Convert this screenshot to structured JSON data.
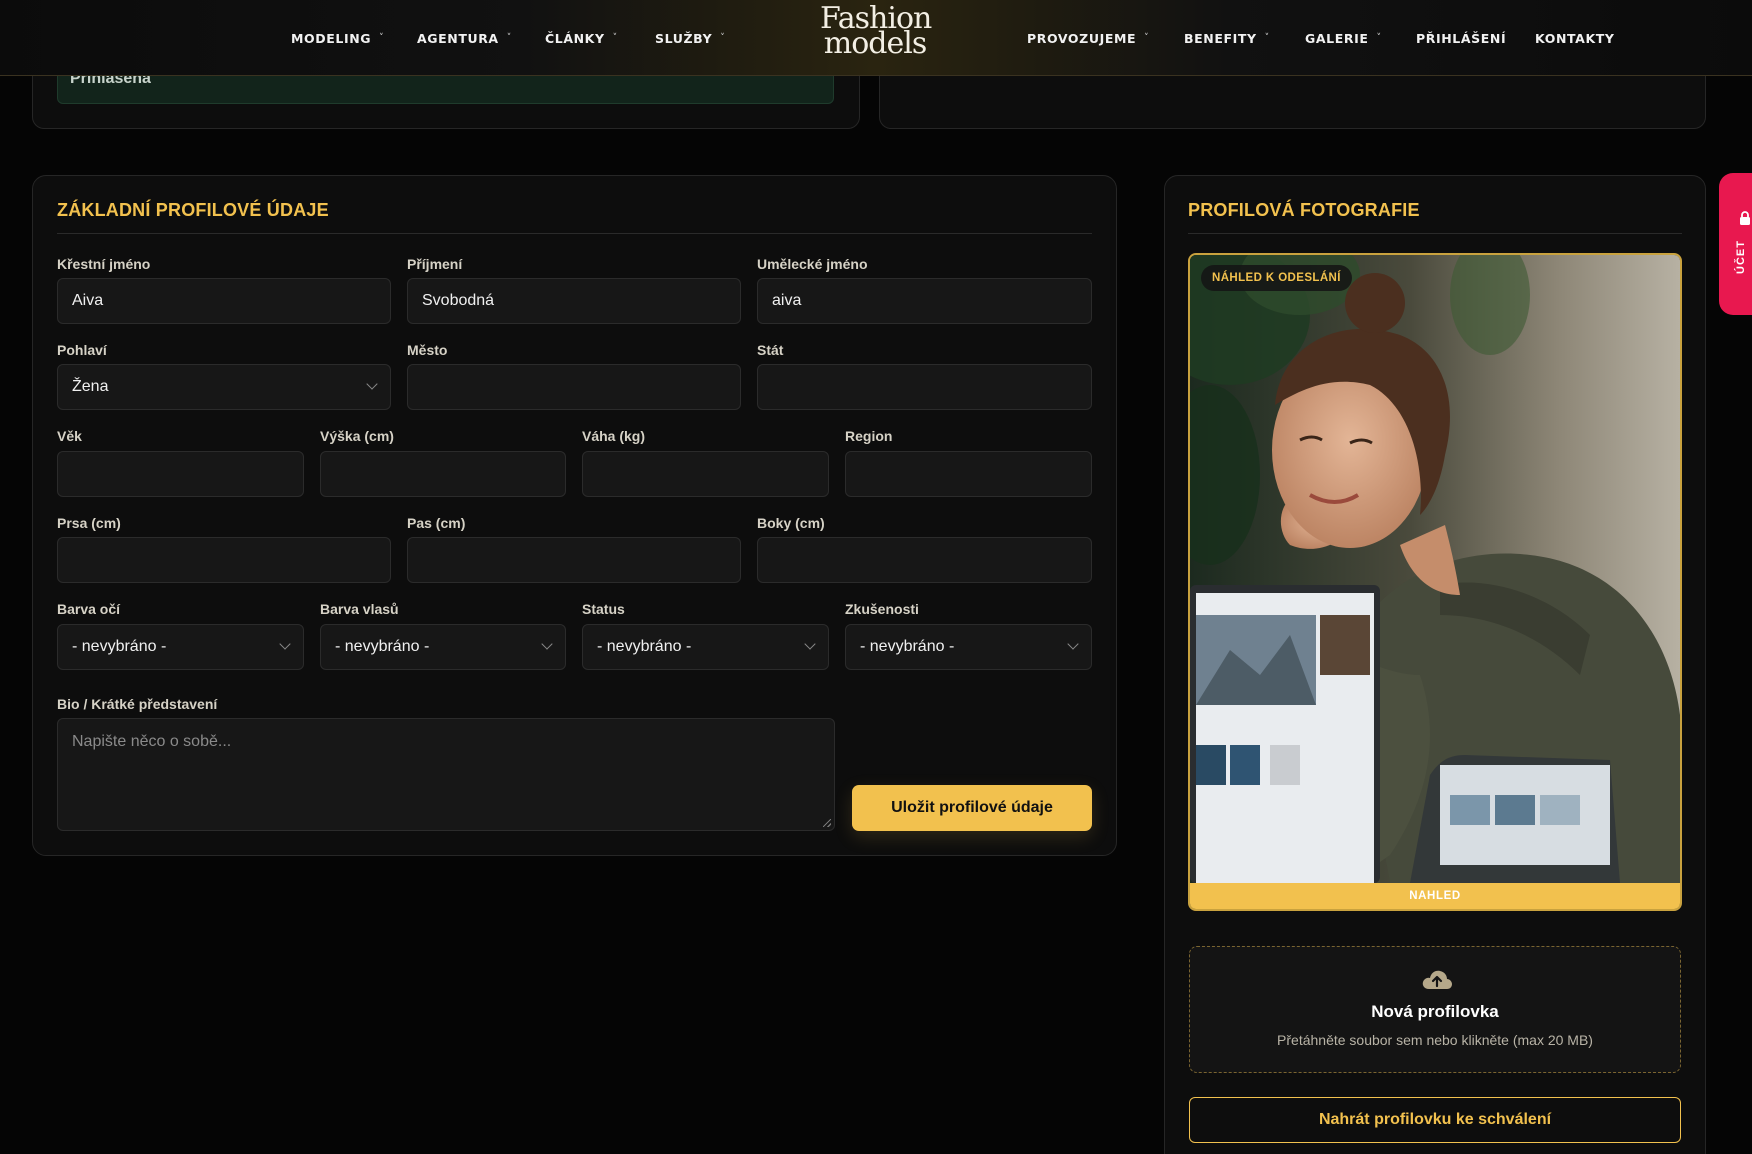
{
  "nav": {
    "left": [
      {
        "label": "MODELING",
        "caret": "˅"
      },
      {
        "label": "AGENTURA",
        "caret": "˅"
      },
      {
        "label": "ČLÁNKY",
        "caret": "˅"
      },
      {
        "label": "SLUŽBY",
        "caret": "˅"
      }
    ],
    "logo": {
      "line1": "Fashion",
      "line2": "models"
    },
    "right": [
      {
        "label": "PROVOZUJEME",
        "caret": "˅"
      },
      {
        "label": "BENEFITY",
        "caret": "˅"
      },
      {
        "label": "GALERIE",
        "caret": "˅"
      },
      {
        "label": "PŘIHLÁŠENÍ"
      },
      {
        "label": "KONTAKTY"
      }
    ]
  },
  "top": {
    "status_text": "Přihlášena"
  },
  "profile_form": {
    "title": "ZÁKLADNÍ PROFILOVÉ ÚDAJE",
    "fields": {
      "first_name": {
        "label": "Křestní jméno",
        "value": "Aiva"
      },
      "last_name": {
        "label": "Příjmení",
        "value": "Svobodná"
      },
      "stage_name": {
        "label": "Umělecké jméno",
        "value": "aiva"
      },
      "gender": {
        "label": "Pohlaví",
        "value": "Žena"
      },
      "city": {
        "label": "Město",
        "value": ""
      },
      "country": {
        "label": "Stát",
        "value": ""
      },
      "age": {
        "label": "Věk",
        "value": ""
      },
      "height": {
        "label": "Výška (cm)",
        "value": ""
      },
      "weight": {
        "label": "Váha (kg)",
        "value": ""
      },
      "region": {
        "label": "Region",
        "value": ""
      },
      "bust": {
        "label": "Prsa (cm)",
        "value": ""
      },
      "waist": {
        "label": "Pas (cm)",
        "value": ""
      },
      "hips": {
        "label": "Boky (cm)",
        "value": ""
      },
      "eye_color": {
        "label": "Barva očí",
        "value": "- nevybráno -"
      },
      "hair_color": {
        "label": "Barva vlasů",
        "value": "- nevybráno -"
      },
      "status": {
        "label": "Status",
        "value": "- nevybráno -"
      },
      "experience": {
        "label": "Zkušenosti",
        "value": "- nevybráno -"
      },
      "bio": {
        "label": "Bio / Krátké představení",
        "placeholder": "Napište něco o sobě..."
      }
    },
    "save_label": "Uložit profilové údaje"
  },
  "photo": {
    "title": "PROFILOVÁ FOTOGRAFIE",
    "badge": "NÁHLED K ODESLÁNÍ",
    "caption": "NAHLED",
    "dropzone_title": "Nová profilovka",
    "dropzone_sub": "Přetáhněte soubor sem nebo klikněte (max 20 MB)",
    "upload_label": "Nahrát profilovku ke schválení"
  },
  "account_tab": {
    "label": "ÚČET"
  },
  "colors": {
    "accent": "#f2c14e",
    "account": "#e8184f",
    "background": "#050505",
    "card": "#0d0d0d"
  }
}
